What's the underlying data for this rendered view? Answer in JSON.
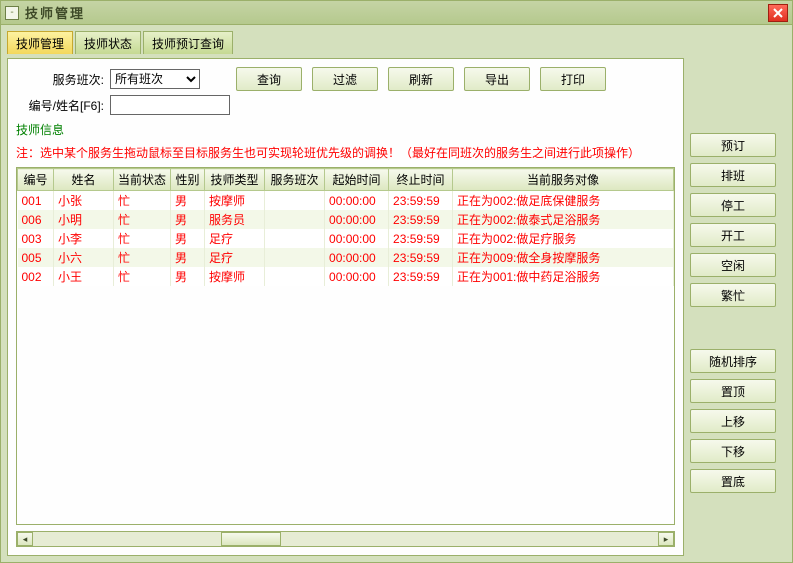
{
  "window": {
    "title": "技师管理",
    "minimize_glyph": "-"
  },
  "tabs": [
    {
      "label": "技师管理",
      "active": true
    },
    {
      "label": "技师状态",
      "active": false
    },
    {
      "label": "技师预订查询",
      "active": false
    }
  ],
  "form": {
    "shift_label": "服务班次:",
    "shift_value": "所有班次",
    "idname_label": "编号/姓名[F6]:",
    "idname_value": ""
  },
  "toolbar": {
    "query": "查询",
    "filter": "过滤",
    "refresh": "刷新",
    "export": "导出",
    "print": "打印"
  },
  "group_label": "技师信息",
  "note": "注：选中某个服务生拖动鼠标至目标服务生也可实现轮班优先级的调换！（最好在同班次的服务生之间进行此项操作）",
  "columns": {
    "id": "编号",
    "name": "姓名",
    "state": "当前状态",
    "gender": "性别",
    "type": "技师类型",
    "shift": "服务班次",
    "start": "起始时间",
    "end": "终止时间",
    "target": "当前服务对像"
  },
  "rows": [
    {
      "id": "001",
      "name": "小张",
      "state": "忙",
      "gender": "男",
      "type": "按摩师",
      "shift": "",
      "start": "00:00:00",
      "end": "23:59:59",
      "target": "正在为002:做足底保健服务"
    },
    {
      "id": "006",
      "name": "小明",
      "state": "忙",
      "gender": "男",
      "type": "服务员",
      "shift": "",
      "start": "00:00:00",
      "end": "23:59:59",
      "target": "正在为002:做泰式足浴服务"
    },
    {
      "id": "003",
      "name": "小李",
      "state": "忙",
      "gender": "男",
      "type": "足疗",
      "shift": "",
      "start": "00:00:00",
      "end": "23:59:59",
      "target": "正在为002:做足疗服务"
    },
    {
      "id": "005",
      "name": "小六",
      "state": "忙",
      "gender": "男",
      "type": "足疗",
      "shift": "",
      "start": "00:00:00",
      "end": "23:59:59",
      "target": "正在为009:做全身按摩服务"
    },
    {
      "id": "002",
      "name": "小王",
      "state": "忙",
      "gender": "男",
      "type": "按摩师",
      "shift": "",
      "start": "00:00:00",
      "end": "23:59:59",
      "target": "正在为001:做中药足浴服务"
    }
  ],
  "side_buttons": {
    "group1": [
      {
        "key": "reserve",
        "label": "预订"
      },
      {
        "key": "schedule",
        "label": "排班"
      },
      {
        "key": "stop",
        "label": "停工"
      },
      {
        "key": "start",
        "label": "开工"
      },
      {
        "key": "idle",
        "label": "空闲"
      },
      {
        "key": "busy",
        "label": "繁忙"
      }
    ],
    "group2": [
      {
        "key": "random",
        "label": "随机排序"
      },
      {
        "key": "top",
        "label": "置顶"
      },
      {
        "key": "up",
        "label": "上移"
      },
      {
        "key": "down",
        "label": "下移"
      },
      {
        "key": "bottom",
        "label": "置底"
      }
    ]
  }
}
